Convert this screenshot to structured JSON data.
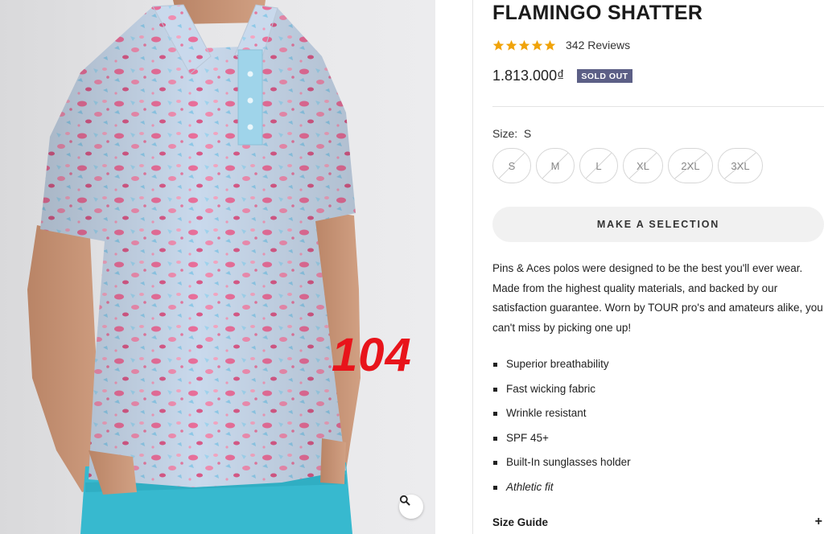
{
  "product": {
    "title": "FLAMINGO SHATTER",
    "rating": {
      "stars": 5,
      "star_color": "#f0a30a",
      "reviews_label": "342 Reviews"
    },
    "price": "1.813.000₫",
    "status_badge": "SOLD OUT",
    "badge_color": "#5c5f86",
    "size_label": "Size:",
    "size_selected": "S",
    "sizes": [
      {
        "label": "S",
        "available": false
      },
      {
        "label": "M",
        "available": false
      },
      {
        "label": "L",
        "available": false
      },
      {
        "label": "XL",
        "available": false
      },
      {
        "label": "2XL",
        "available": false
      },
      {
        "label": "3XL",
        "available": false
      }
    ],
    "cta_label": "MAKE A SELECTION",
    "description": "Pins & Aces polos were designed to be the best you'll ever wear. Made from the highest quality materials, and backed by our satisfaction  guarantee. Worn by TOUR pro's and amateurs alike,  you can't miss by picking one up!",
    "features": [
      "Superior breathability",
      "Fast wicking fabric",
      "Wrinkle resistant",
      "SPF 45+",
      "Built-In sunglasses holder",
      "Athletic fit"
    ],
    "size_guide_label": "Size Guide",
    "size_guide_toggle": "+"
  },
  "gallery": {
    "watermark": "104",
    "zoom_icon": "magnifier-icon"
  }
}
